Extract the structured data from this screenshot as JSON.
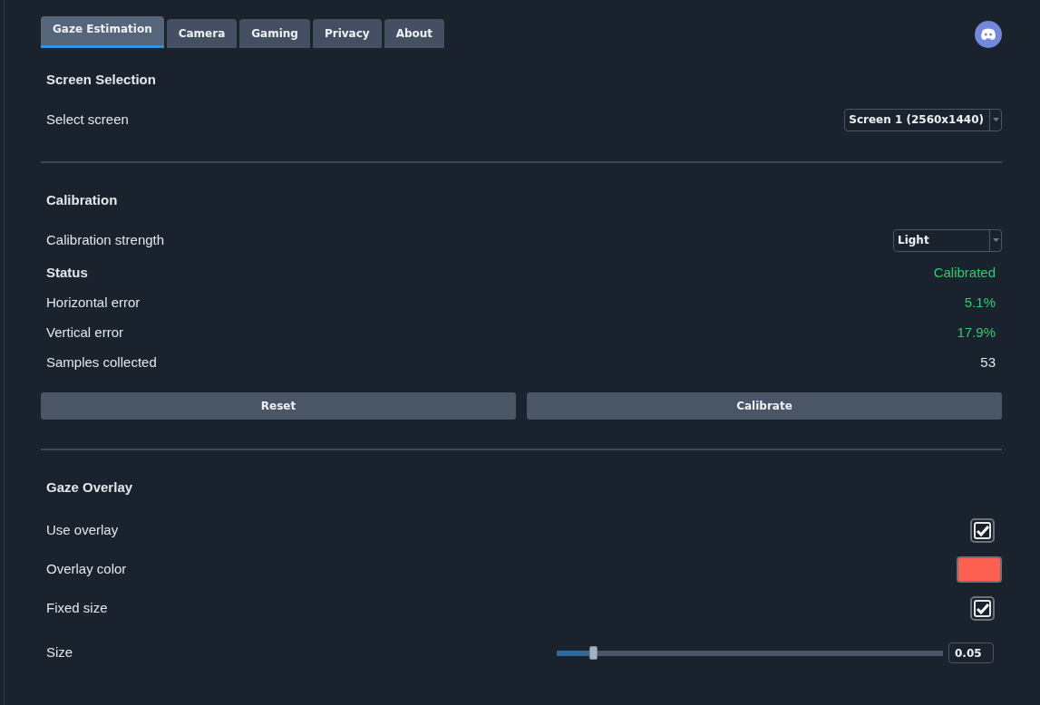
{
  "tabs": [
    {
      "label": "Gaze Estimation",
      "selected": true
    },
    {
      "label": "Camera",
      "selected": false
    },
    {
      "label": "Gaming",
      "selected": false
    },
    {
      "label": "Privacy",
      "selected": false
    },
    {
      "label": "About",
      "selected": false
    }
  ],
  "sections": [
    {
      "title": "Screen Selection",
      "rows": [
        {
          "kind": "dropdown",
          "label": "Select screen",
          "value": "Screen 1 (2560x1440)"
        }
      ]
    },
    {
      "title": "Calibration",
      "rows": [
        {
          "kind": "dropdown",
          "label": "Calibration strength",
          "value": "Light"
        },
        {
          "kind": "value",
          "label": "Status",
          "bold": true,
          "value": "Calibrated",
          "color": "#2ecc71"
        },
        {
          "kind": "value",
          "label": "Horizontal error",
          "bold": false,
          "value": "5.1%",
          "color": "#2ecc71"
        },
        {
          "kind": "value",
          "label": "Vertical error",
          "bold": false,
          "value": "17.9%",
          "color": "#2ecc71"
        },
        {
          "kind": "value",
          "label": "Samples collected",
          "bold": false,
          "value": "53",
          "color": "#e3e6ea"
        },
        {
          "kind": "buttons",
          "buttons": [
            "Reset",
            "Calibrate"
          ]
        }
      ]
    },
    {
      "title": "Gaze Overlay",
      "rows": [
        {
          "kind": "checkbox",
          "label": "Use overlay",
          "checked": true
        },
        {
          "kind": "color",
          "label": "Overlay color",
          "color": "#fd6050"
        },
        {
          "kind": "checkbox",
          "label": "Fixed size",
          "checked": true
        },
        {
          "kind": "slider",
          "label": "Size",
          "level": 0.094,
          "reading": "0.05"
        }
      ]
    }
  ]
}
